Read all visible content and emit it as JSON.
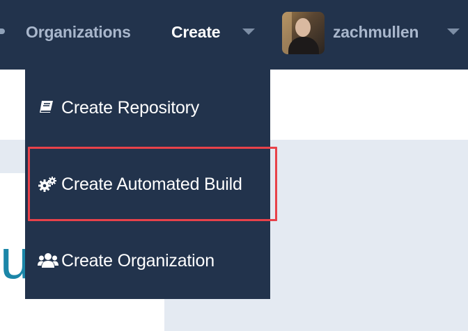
{
  "navbar": {
    "organizations_label": "Organizations",
    "create_label": "Create",
    "username": "zachmullen",
    "caret_icon": "chevron-down-icon",
    "avatar_icon": "user-avatar"
  },
  "dropdown": {
    "items": [
      {
        "label": "Create Repository",
        "icon": "book-icon"
      },
      {
        "label": "Create Automated Build",
        "icon": "gears-icon"
      },
      {
        "label": "Create Organization",
        "icon": "users-icon"
      }
    ]
  },
  "page": {
    "fragment_text": "ur"
  },
  "colors": {
    "navbar_bg": "#22334c",
    "nav_text": "#a9b7cc",
    "active_text": "#ffffff",
    "panel_bg": "#e4eaf2",
    "highlight": "#e8424a",
    "accent_text": "#1b86a8"
  }
}
